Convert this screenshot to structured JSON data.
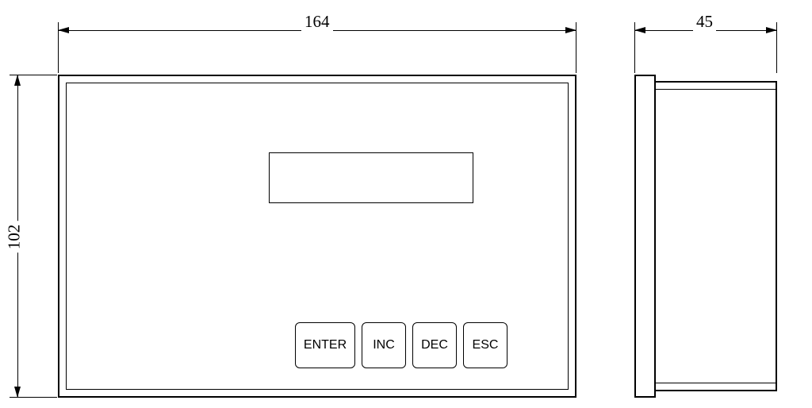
{
  "dimensions": {
    "width": "164",
    "height": "102",
    "depth": "45"
  },
  "buttons": {
    "enter": "ENTER",
    "inc": "INC",
    "dec": "DEC",
    "esc": "ESC"
  }
}
